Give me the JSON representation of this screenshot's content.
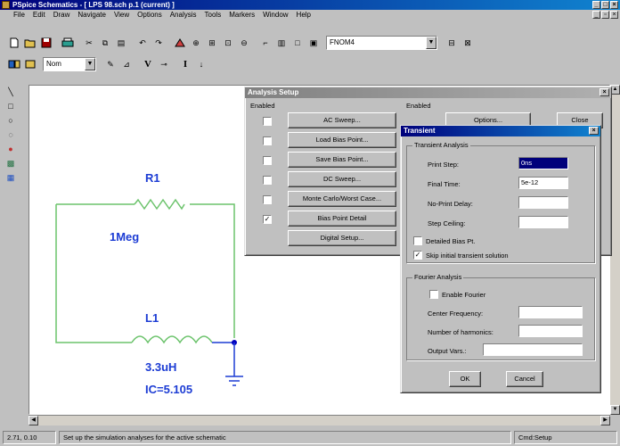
{
  "app": {
    "title": "PSpice Schematics - [ LPS 98.sch  p.1 (current) ]"
  },
  "menu": {
    "items": [
      "File",
      "Edit",
      "Draw",
      "Navigate",
      "View",
      "Options",
      "Analysis",
      "Tools",
      "Markers",
      "Window",
      "Help"
    ]
  },
  "toolbar1": {
    "part_combo_value": "FNOM4"
  },
  "toolbar2": {
    "combo_value": "Nom",
    "v_label": "V",
    "i_label": "I"
  },
  "schematic": {
    "r1": {
      "ref": "R1",
      "value": "1Meg"
    },
    "l1": {
      "ref": "L1",
      "value": "3.3uH",
      "ic": "IC=5.105"
    }
  },
  "analysis_setup": {
    "title": "Analysis Setup",
    "enabled_header": "Enabled",
    "enabled_header_right": "Enabled",
    "close_label": "Close",
    "options_label": "Options...",
    "rows": [
      {
        "label": "AC Sweep...",
        "checked": false
      },
      {
        "label": "Load Bias Point...",
        "checked": false
      },
      {
        "label": "Save Bias Point...",
        "checked": false
      },
      {
        "label": "DC Sweep...",
        "checked": false
      },
      {
        "label": "Monte Carlo/Worst Case...",
        "checked": false
      },
      {
        "label": "Bias Point Detail",
        "checked": true
      },
      {
        "label": "Digital Setup...",
        "checked": false
      }
    ]
  },
  "transient": {
    "title": "Transient",
    "group_transient": "Transient Analysis",
    "print_step_label": "Print Step:",
    "print_step_value": "0ns",
    "final_time_label": "Final Time:",
    "final_time_value": "5e-12",
    "no_print_delay_label": "No-Print Delay:",
    "no_print_delay_value": "",
    "step_ceiling_label": "Step Ceiling:",
    "step_ceiling_value": "",
    "detailed_bias_label": "Detailed Bias Pt.",
    "skip_initial_label": "Skip initial transient solution",
    "skip_initial_checked": true,
    "group_fourier": "Fourier Analysis",
    "enable_fourier_label": "Enable Fourier",
    "center_freq_label": "Center Frequency:",
    "num_harmonics_label": "Number of harmonics:",
    "output_vars_label": "Output Vars.:",
    "ok_label": "OK",
    "cancel_label": "Cancel"
  },
  "status": {
    "coords": "2.71, 0.10",
    "message": "Set up the simulation analyses for the active schematic",
    "mode": "Cmd:Setup"
  },
  "colors": {
    "title_blue": "#00007b",
    "wire_green": "#6cc36c",
    "component_blue": "#1c3cd4",
    "node_blue": "#0000c0"
  }
}
